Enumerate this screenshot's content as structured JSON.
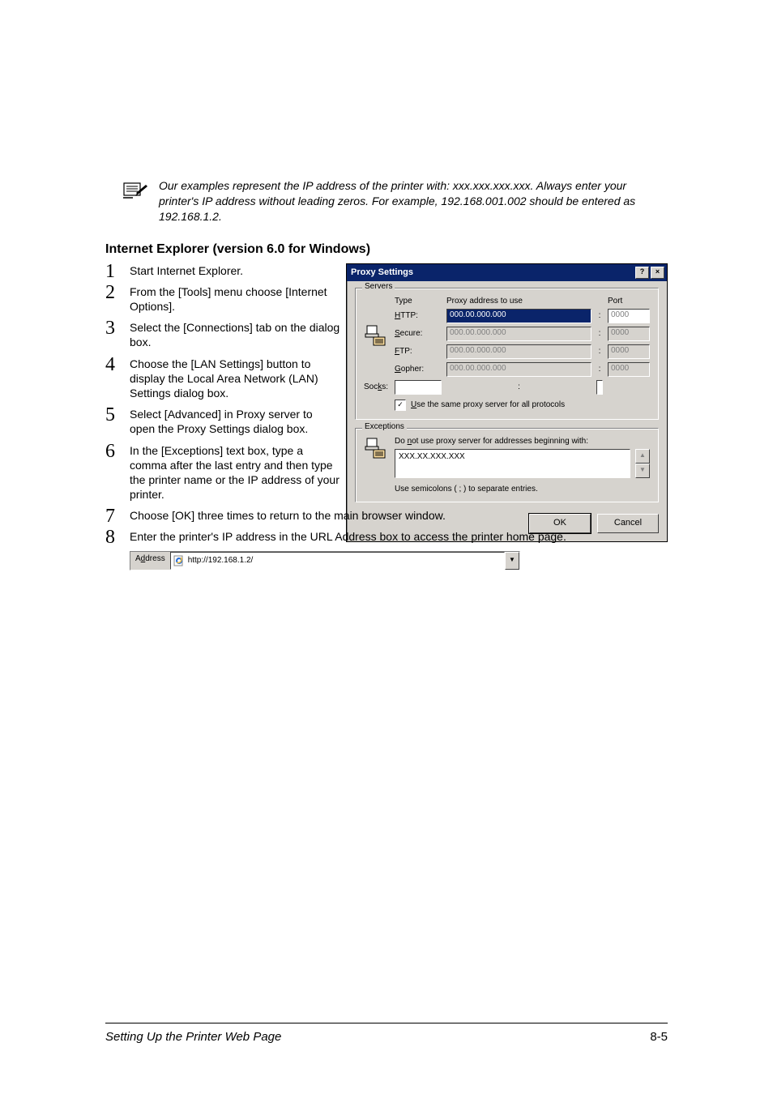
{
  "note": {
    "text": "Our examples represent the IP address of the printer with: xxx.xxx.xxx.xxx. Always enter your printer's IP address without leading zeros. For example, 192.168.001.002 should be entered as 192.168.1.2."
  },
  "heading": "Internet Explorer (version 6.0 for Windows)",
  "steps": [
    "Start Internet Explorer.",
    "From the [Tools] menu choose [Internet Options].",
    "Select the [Connections] tab on the dialog box.",
    "Choose the [LAN Settings] button to display the Local Area Network (LAN) Settings dialog box.",
    "Select [Advanced] in Proxy server to open the Proxy Settings dialog box.",
    "In the [Exceptions] text box, type a comma after the last entry and then type the printer name or the IP address of your printer.",
    "Choose [OK] three times to return to the main browser window.",
    "Enter the printer's IP address in the URL Address box to access the printer home page."
  ],
  "dialog": {
    "title": "Proxy Settings",
    "help_btn": "?",
    "close_btn": "×",
    "servers": {
      "legend": "Servers",
      "col_type": "Type",
      "col_addr": "Proxy address to use",
      "col_port": "Port",
      "rows": [
        {
          "label": "HTTP:",
          "addr": "000.00.000.000",
          "port": "0000",
          "enabled": true,
          "highlight": true
        },
        {
          "label": "Secure:",
          "addr": "000.00.000.000",
          "port": "0000",
          "enabled": false,
          "highlight": false
        },
        {
          "label": "FTP:",
          "addr": "000.00.000.000",
          "port": "0000",
          "enabled": false,
          "highlight": false
        },
        {
          "label": "Gopher:",
          "addr": "000.00.000.000",
          "port": "0000",
          "enabled": false,
          "highlight": false
        },
        {
          "label": "Socks:",
          "addr": "",
          "port": "",
          "enabled": true,
          "highlight": false
        }
      ],
      "same_proxy": "Use the same proxy server for all protocols"
    },
    "exceptions": {
      "legend": "Exceptions",
      "instr": "Do not use proxy server for addresses beginning with:",
      "value": "XXX.XX.XXX.XXX",
      "hint": "Use semicolons ( ; ) to separate entries."
    },
    "ok": "OK",
    "cancel": "Cancel"
  },
  "addressbar": {
    "label": "Address",
    "url": "http://192.168.1.2/"
  },
  "footer": {
    "title": "Setting Up the Printer Web Page",
    "pageno": "8-5"
  }
}
